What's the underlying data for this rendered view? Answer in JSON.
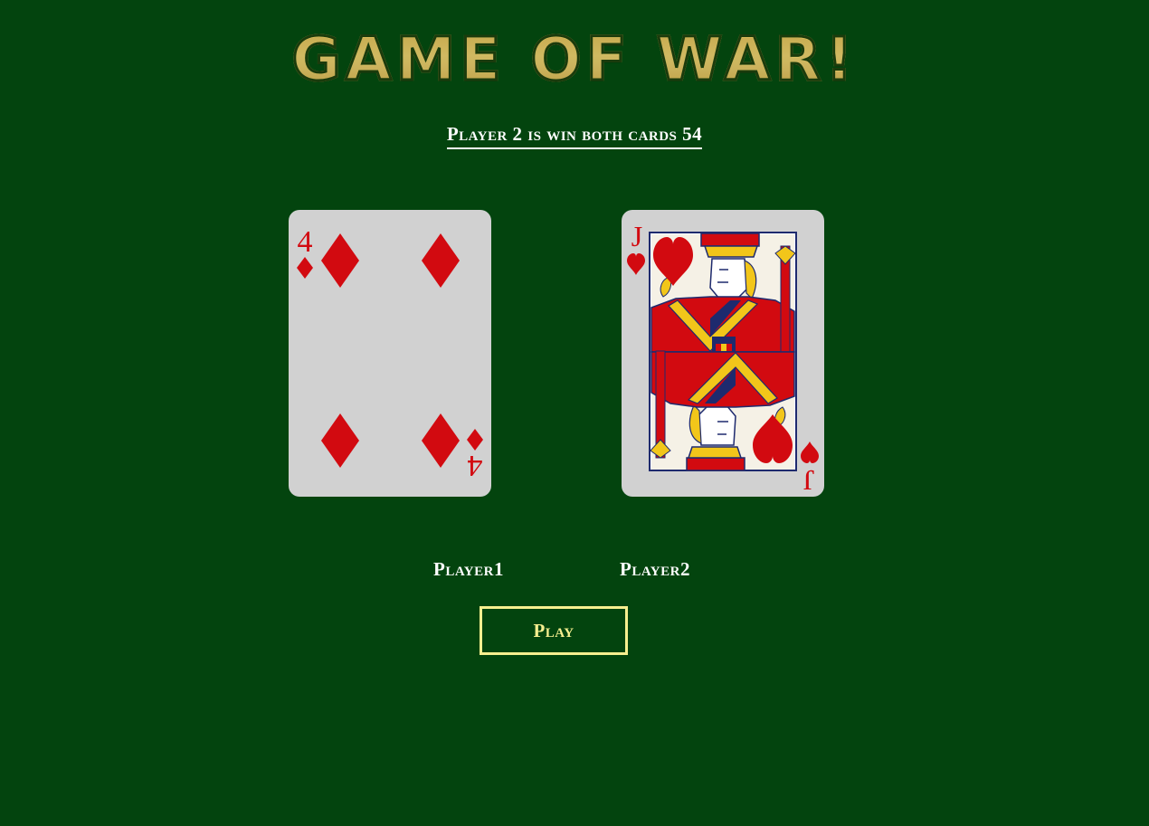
{
  "title": "Game of War!",
  "status": "Player 2 is win both cards 54",
  "cards": [
    {
      "rank": "4",
      "suit": "diamonds",
      "suit_icon": "diamond-icon",
      "color": "#d20a10"
    },
    {
      "rank": "J",
      "suit": "hearts",
      "suit_icon": "heart-icon",
      "color": "#d20a10",
      "face": "jack-of-hearts-illustration"
    }
  ],
  "players": {
    "player1_label": "Player1",
    "player2_label": "Player2"
  },
  "play_button": {
    "label": "Play"
  },
  "colors": {
    "background": "#03440e",
    "title_gold": "#f1cd5d",
    "button_accent": "#f6ef8f",
    "card_face": "#d1d1d1",
    "card_red": "#d20a10",
    "card_blue": "#1e2a6e",
    "card_yellow": "#f2c61a"
  }
}
